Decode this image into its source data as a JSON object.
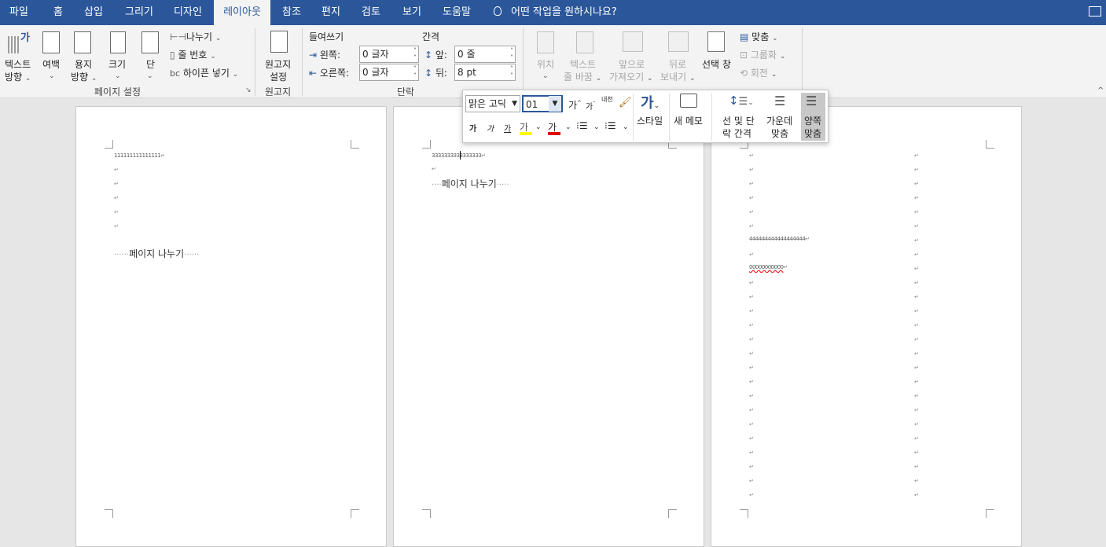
{
  "tabs": [
    {
      "label": "파일",
      "name": "tab-file"
    },
    {
      "label": "홈",
      "name": "tab-home"
    },
    {
      "label": "삽입",
      "name": "tab-insert"
    },
    {
      "label": "그리기",
      "name": "tab-draw"
    },
    {
      "label": "디자인",
      "name": "tab-design"
    },
    {
      "label": "레이아웃",
      "name": "tab-layout"
    },
    {
      "label": "참조",
      "name": "tab-references"
    },
    {
      "label": "편지",
      "name": "tab-mailings"
    },
    {
      "label": "검토",
      "name": "tab-review"
    },
    {
      "label": "보기",
      "name": "tab-view"
    },
    {
      "label": "도움말",
      "name": "tab-help"
    }
  ],
  "active_tab": "레이아웃",
  "tell_me": "어떤 작업을 원하시나요?",
  "ribbon": {
    "page_setup": {
      "text_direction": [
        "텍스트",
        "방향"
      ],
      "margins": "여백",
      "orientation": [
        "용지",
        "방향"
      ],
      "size": "크기",
      "columns": "단",
      "breaks": "나누기",
      "line_numbers": "줄 번호",
      "hyphenation": "하이픈 넣기",
      "group_label": "페이지 설정"
    },
    "manuscript": {
      "button": [
        "원고지",
        "설정"
      ],
      "group_label": "원고지"
    },
    "paragraph": {
      "indent_title": "들여쓰기",
      "spacing_title": "간격",
      "left_label": "왼쪽:",
      "left_value": "0 글자",
      "right_label": "오른쪽:",
      "right_value": "0 글자",
      "before_label": "앞:",
      "before_value": "0 줄",
      "after_label": "뒤:",
      "after_value": "8 pt",
      "group_label": "단락"
    },
    "arrange": {
      "position": "위치",
      "wrap_text": [
        "텍스트",
        "줄 바꿈"
      ],
      "bring_forward": [
        "앞으로",
        "가져오기"
      ],
      "send_backward": [
        "뒤로",
        "보내기"
      ],
      "selection_pane": "선택 창",
      "align": "맞춤",
      "group": "그룹화",
      "rotate": "회전"
    }
  },
  "pages": [
    {
      "first_line": "111111111111111",
      "page_break": "페이지 나누기"
    },
    {
      "first_line": "3333333333333333",
      "page_break": "페이지 나누기"
    },
    {
      "line_a": "444444444444444444",
      "line_b": "00000000000"
    }
  ],
  "para_mark": "↵",
  "mini_toolbar": {
    "font_name": "맑은 고딕",
    "font_size": "01",
    "grow_font": "가",
    "shrink_font": "가",
    "phonetic": "내천",
    "bold": "가",
    "italic": "가",
    "underline": "가",
    "highlight": "가",
    "font_color": "가",
    "styles_label": "스타일",
    "styles_glyph": "가",
    "new_comment": "새 메모",
    "line_spacing": [
      "선 및 단",
      "락 간격"
    ],
    "center": [
      "가운데",
      "맞춤"
    ],
    "justify": [
      "양쪽",
      "맞춤"
    ]
  },
  "colors": {
    "accent": "#2b579a",
    "highlight": "#ffff00",
    "font_color_bar": "#e00000"
  }
}
